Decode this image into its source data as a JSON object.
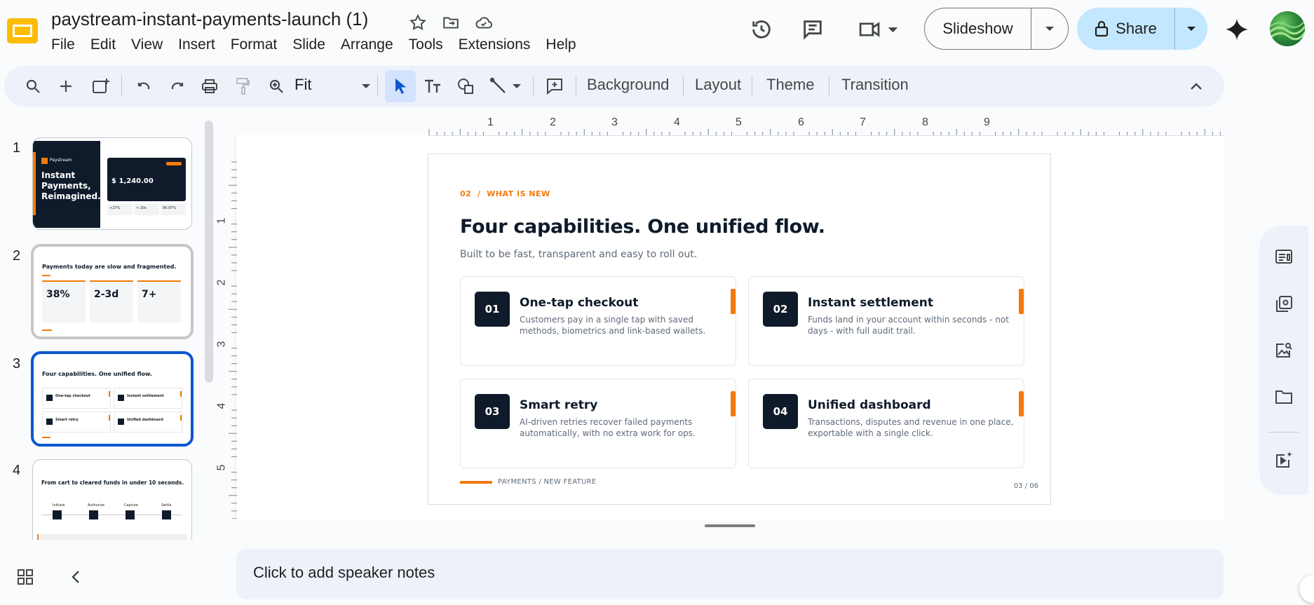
{
  "app": {
    "doc_title": "paystream-instant-payments-launch (1)",
    "menu": [
      "File",
      "Edit",
      "View",
      "Insert",
      "Format",
      "Slide",
      "Arrange",
      "Tools",
      "Extensions",
      "Help"
    ],
    "slideshow_label": "Slideshow",
    "share_label": "Share"
  },
  "toolbar": {
    "zoom_label": "Fit",
    "background_label": "Background",
    "layout_label": "Layout",
    "theme_label": "Theme",
    "transition_label": "Transition"
  },
  "filmstrip": {
    "slides": [
      {
        "number": "1",
        "title": "Instant Payments, Reimagined.",
        "brand": "Paystream",
        "amount": "$ 1,240.00",
        "stats": [
          "+27%",
          "< 10s",
          "99.97%"
        ]
      },
      {
        "number": "2",
        "title": "Payments today are slow and fragmented.",
        "stats": [
          "38%",
          "2-3d",
          "7+"
        ]
      },
      {
        "number": "3",
        "title": "Four capabilities. One unified flow.",
        "items": [
          "One-tap checkout",
          "Instant settlement",
          "Smart retry",
          "Unified dashboard"
        ]
      },
      {
        "number": "4",
        "title": "From cart to cleared funds in under 10 seconds.",
        "steps": [
          "Initiate",
          "Authorize",
          "Capture",
          "Settle"
        ]
      }
    ]
  },
  "ruler": {
    "h_numbers": [
      "1",
      "2",
      "3",
      "4",
      "5",
      "6",
      "7",
      "8",
      "9"
    ],
    "v_numbers": [
      "1",
      "2",
      "3",
      "4",
      "5"
    ]
  },
  "slide": {
    "eyebrow": "02  /  WHAT IS NEW",
    "title": "Four capabilities. One unified flow.",
    "subtitle": "Built to be fast, transparent and easy to roll out.",
    "cards": [
      {
        "num": "01",
        "title": "One-tap checkout",
        "desc": "Customers pay in a single tap with saved methods, biometrics and link-based wallets."
      },
      {
        "num": "02",
        "title": "Instant settlement",
        "desc": "Funds land in your account within seconds - not days - with full audit trail."
      },
      {
        "num": "03",
        "title": "Smart retry",
        "desc": "AI-driven retries recover failed payments automatically, with no extra work for ops."
      },
      {
        "num": "04",
        "title": "Unified dashboard",
        "desc": "Transactions, disputes and revenue in one place, exportable with a single click."
      }
    ],
    "footer": "PAYMENTS / NEW FEATURE",
    "page": "03 / 06"
  },
  "notes": {
    "placeholder": "Click to add speaker notes"
  },
  "colors": {
    "accent": "#f47b0b",
    "navy": "#0f1b2a",
    "selection_blue": "#0b57d0"
  }
}
